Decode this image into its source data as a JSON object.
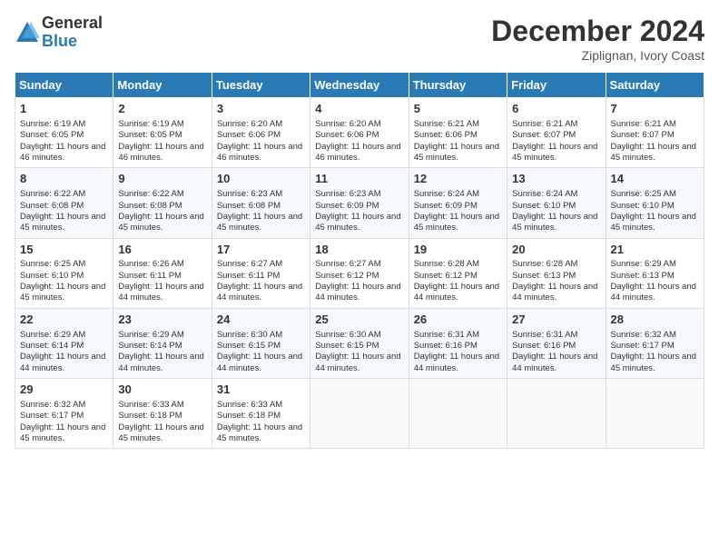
{
  "logo": {
    "general": "General",
    "blue": "Blue"
  },
  "title": "December 2024",
  "subtitle": "Ziplignan, Ivory Coast",
  "days_of_week": [
    "Sunday",
    "Monday",
    "Tuesday",
    "Wednesday",
    "Thursday",
    "Friday",
    "Saturday"
  ],
  "weeks": [
    [
      {
        "day": "1",
        "sunrise": "6:19 AM",
        "sunset": "6:05 PM",
        "daylight": "11 hours and 46 minutes."
      },
      {
        "day": "2",
        "sunrise": "6:19 AM",
        "sunset": "6:05 PM",
        "daylight": "11 hours and 46 minutes."
      },
      {
        "day": "3",
        "sunrise": "6:20 AM",
        "sunset": "6:06 PM",
        "daylight": "11 hours and 46 minutes."
      },
      {
        "day": "4",
        "sunrise": "6:20 AM",
        "sunset": "6:06 PM",
        "daylight": "11 hours and 46 minutes."
      },
      {
        "day": "5",
        "sunrise": "6:21 AM",
        "sunset": "6:06 PM",
        "daylight": "11 hours and 45 minutes."
      },
      {
        "day": "6",
        "sunrise": "6:21 AM",
        "sunset": "6:07 PM",
        "daylight": "11 hours and 45 minutes."
      },
      {
        "day": "7",
        "sunrise": "6:21 AM",
        "sunset": "6:07 PM",
        "daylight": "11 hours and 45 minutes."
      }
    ],
    [
      {
        "day": "8",
        "sunrise": "6:22 AM",
        "sunset": "6:08 PM",
        "daylight": "11 hours and 45 minutes."
      },
      {
        "day": "9",
        "sunrise": "6:22 AM",
        "sunset": "6:08 PM",
        "daylight": "11 hours and 45 minutes."
      },
      {
        "day": "10",
        "sunrise": "6:23 AM",
        "sunset": "6:08 PM",
        "daylight": "11 hours and 45 minutes."
      },
      {
        "day": "11",
        "sunrise": "6:23 AM",
        "sunset": "6:09 PM",
        "daylight": "11 hours and 45 minutes."
      },
      {
        "day": "12",
        "sunrise": "6:24 AM",
        "sunset": "6:09 PM",
        "daylight": "11 hours and 45 minutes."
      },
      {
        "day": "13",
        "sunrise": "6:24 AM",
        "sunset": "6:10 PM",
        "daylight": "11 hours and 45 minutes."
      },
      {
        "day": "14",
        "sunrise": "6:25 AM",
        "sunset": "6:10 PM",
        "daylight": "11 hours and 45 minutes."
      }
    ],
    [
      {
        "day": "15",
        "sunrise": "6:25 AM",
        "sunset": "6:10 PM",
        "daylight": "11 hours and 45 minutes."
      },
      {
        "day": "16",
        "sunrise": "6:26 AM",
        "sunset": "6:11 PM",
        "daylight": "11 hours and 44 minutes."
      },
      {
        "day": "17",
        "sunrise": "6:27 AM",
        "sunset": "6:11 PM",
        "daylight": "11 hours and 44 minutes."
      },
      {
        "day": "18",
        "sunrise": "6:27 AM",
        "sunset": "6:12 PM",
        "daylight": "11 hours and 44 minutes."
      },
      {
        "day": "19",
        "sunrise": "6:28 AM",
        "sunset": "6:12 PM",
        "daylight": "11 hours and 44 minutes."
      },
      {
        "day": "20",
        "sunrise": "6:28 AM",
        "sunset": "6:13 PM",
        "daylight": "11 hours and 44 minutes."
      },
      {
        "day": "21",
        "sunrise": "6:29 AM",
        "sunset": "6:13 PM",
        "daylight": "11 hours and 44 minutes."
      }
    ],
    [
      {
        "day": "22",
        "sunrise": "6:29 AM",
        "sunset": "6:14 PM",
        "daylight": "11 hours and 44 minutes."
      },
      {
        "day": "23",
        "sunrise": "6:29 AM",
        "sunset": "6:14 PM",
        "daylight": "11 hours and 44 minutes."
      },
      {
        "day": "24",
        "sunrise": "6:30 AM",
        "sunset": "6:15 PM",
        "daylight": "11 hours and 44 minutes."
      },
      {
        "day": "25",
        "sunrise": "6:30 AM",
        "sunset": "6:15 PM",
        "daylight": "11 hours and 44 minutes."
      },
      {
        "day": "26",
        "sunrise": "6:31 AM",
        "sunset": "6:16 PM",
        "daylight": "11 hours and 44 minutes."
      },
      {
        "day": "27",
        "sunrise": "6:31 AM",
        "sunset": "6:16 PM",
        "daylight": "11 hours and 44 minutes."
      },
      {
        "day": "28",
        "sunrise": "6:32 AM",
        "sunset": "6:17 PM",
        "daylight": "11 hours and 45 minutes."
      }
    ],
    [
      {
        "day": "29",
        "sunrise": "6:32 AM",
        "sunset": "6:17 PM",
        "daylight": "11 hours and 45 minutes."
      },
      {
        "day": "30",
        "sunrise": "6:33 AM",
        "sunset": "6:18 PM",
        "daylight": "11 hours and 45 minutes."
      },
      {
        "day": "31",
        "sunrise": "6:33 AM",
        "sunset": "6:18 PM",
        "daylight": "11 hours and 45 minutes."
      },
      null,
      null,
      null,
      null
    ]
  ]
}
